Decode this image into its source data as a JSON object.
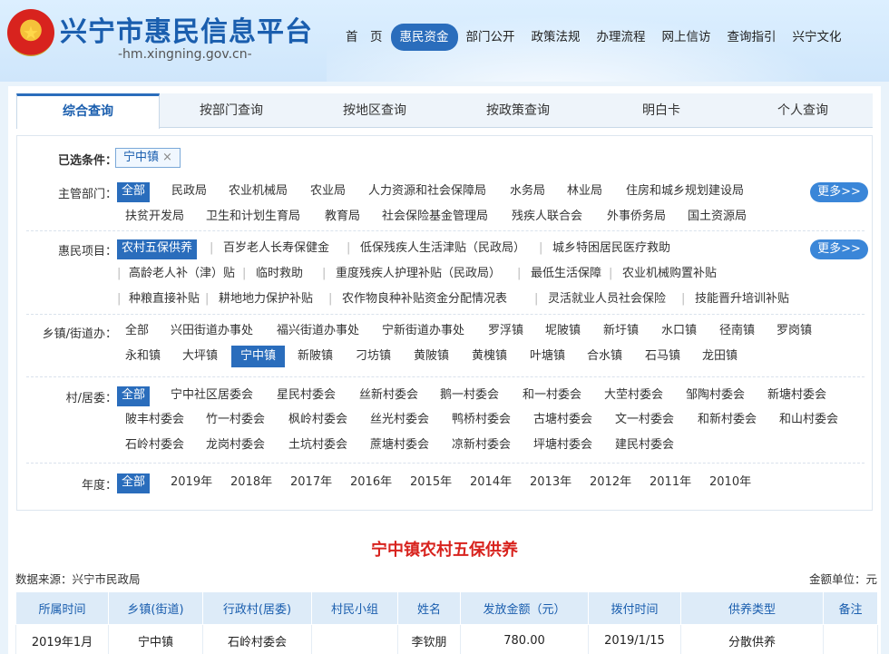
{
  "site": {
    "title": "兴宁市惠民信息平台",
    "domain": "-hm.xingning.gov.cn-",
    "emblem_glyph": "★"
  },
  "topnav": [
    "首　页",
    "惠民资金",
    "部门公开",
    "政策法规",
    "办理流程",
    "网上信访",
    "查询指引",
    "兴宁文化"
  ],
  "tabs": [
    "综合查询",
    "按部门查询",
    "按地区查询",
    "按政策查询",
    "明白卡",
    "个人查询"
  ],
  "filters": {
    "selected_label": "已选条件：",
    "selected_chip": "宁中镇",
    "selected_close": "×",
    "more_label": "更多>>",
    "dept_label": "主管部门：",
    "dept_row1": [
      "全部",
      "民政局",
      "农业机械局",
      "农业局",
      "人力资源和社会保障局",
      "水务局",
      "林业局",
      "住房和城乡规划建设局"
    ],
    "dept_row2": [
      "扶贫开发局",
      "卫生和计划生育局",
      "教育局",
      "社会保险基金管理局",
      "残疾人联合会",
      "外事侨务局",
      "国土资源局"
    ],
    "project_label": "惠民项目：",
    "project_row1": [
      "农村五保供养",
      "百岁老人长寿保健金",
      "低保残疾人生活津贴（民政局）",
      "城乡特困居民医疗救助"
    ],
    "project_row2": [
      "高龄老人补（津）贴",
      "临时救助",
      "重度残疾人护理补贴（民政局）",
      "最低生活保障",
      "农业机械购置补贴"
    ],
    "project_row3": [
      "种粮直接补贴",
      "耕地地力保护补贴",
      "农作物良种补贴资金分配情况表",
      "灵活就业人员社会保险",
      "技能晋升培训补贴"
    ],
    "town_label": "乡镇/街道办：",
    "town_row1": [
      "全部",
      "兴田街道办事处",
      "福兴街道办事处",
      "宁新街道办事处",
      "罗浮镇",
      "坭陂镇",
      "新圩镇",
      "水口镇",
      "径南镇",
      "罗岗镇"
    ],
    "town_row2": [
      "永和镇",
      "大坪镇",
      "宁中镇",
      "新陂镇",
      "刁坊镇",
      "黄陂镇",
      "黄槐镇",
      "叶塘镇",
      "合水镇",
      "石马镇",
      "龙田镇"
    ],
    "village_label": "村/居委：",
    "village_row1": [
      "全部",
      "宁中社区居委会",
      "星民村委会",
      "丝新村委会",
      "鹅一村委会",
      "和一村委会",
      "大茔村委会",
      "邹陶村委会",
      "新塘村委会"
    ],
    "village_row2": [
      "陂丰村委会",
      "竹一村委会",
      "枫岭村委会",
      "丝光村委会",
      "鸭桥村委会",
      "古塘村委会",
      "文一村委会",
      "和新村委会",
      "和山村委会"
    ],
    "village_row3": [
      "石岭村委会",
      "龙岗村委会",
      "土坑村委会",
      "蔗塘村委会",
      "凉新村委会",
      "坪塘村委会",
      "建民村委会"
    ],
    "year_label": "年度：",
    "year_row": [
      "全部",
      "2019年",
      "2018年",
      "2017年",
      "2016年",
      "2015年",
      "2014年",
      "2013年",
      "2012年",
      "2011年",
      "2010年"
    ]
  },
  "result": {
    "title": "宁中镇农村五保供养",
    "source": "数据来源：兴宁市民政局",
    "unit": "金额单位：元",
    "columns": [
      "所属时间",
      "乡镇(街道)",
      "行政村(居委)",
      "村民小组",
      "姓名",
      "发放金额（元）",
      "拨付时间",
      "供养类型",
      "备注"
    ],
    "rows": [
      [
        "2019年1月",
        "宁中镇",
        "石岭村委会",
        "",
        "李钦朋",
        "780.00",
        "2019/1/15",
        "分散供养",
        ""
      ]
    ]
  }
}
